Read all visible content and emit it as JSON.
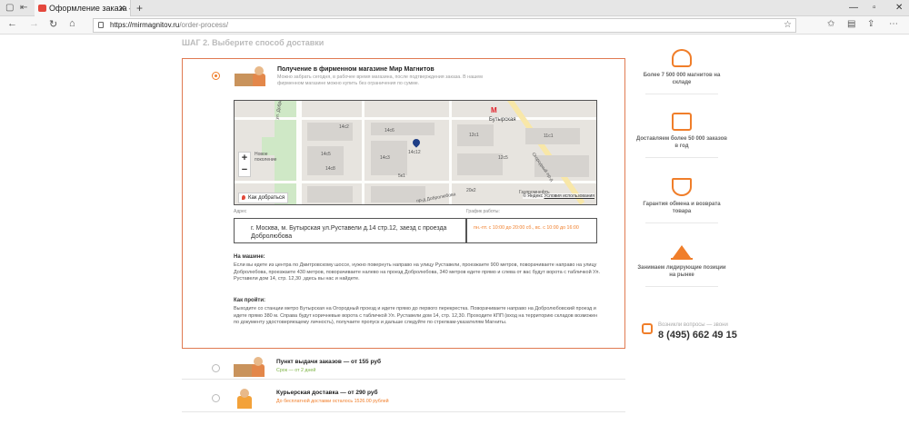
{
  "browser": {
    "tab_title": "Оформление заказа —",
    "url_host": "https://mirmagnitov.ru",
    "url_path": "/order-process/"
  },
  "step_heading": "ШАГ 2. Выберите способ доставки",
  "pickup_store": {
    "title": "Получение в фирменном магазине Мир Магнитов",
    "description": "Можно забрать сегодня, в рабочее время магазина, после подтверждения заказа. В нашем фирменном магазине можно купить без ограничения по сумме.",
    "map": {
      "labels": [
        "Бутырская",
        "14с12",
        "Новое поколение",
        "Огородный пр-д",
        "пр-д Добролюбова",
        "Газпромнефть",
        "ул. Добролюбова",
        "14с3",
        "12с1",
        "12с5",
        "14с2",
        "14с5",
        "14с6",
        "14с8",
        "11с1",
        "5к1",
        "20к2"
      ],
      "zoom_in": "+",
      "zoom_out": "−",
      "route_label": "Как добраться",
      "attribution_prefix": "© Яндекс",
      "attribution_link": "Условия использования"
    },
    "address_label": "Адрес",
    "hours_label": "График работы:",
    "address": "г. Москва, м. Бутырская ул.Руставели д.14 стр.12, заезд с проезда Добролюбова",
    "hours": "пн.-пт. с 10:00 до 20:00 сб., вс. с 10:00 до 16:00",
    "by_car_heading": "На машине:",
    "by_car_text": "Если вы едете из центра по Дмитровскому шоссе, нужно повернуть направо на улицу Руставели, проезжаете 900 метров, поворачиваете направо на улицу Добролюбова, проезжаете 430 метров, поворачиваете налево на проезд Добролюбова, 340 метров едете прямо и слева от вас будут ворота с табличкой Ул. Руставели дом 14, стр. 12,30 ,здесь вы нас и найдете.",
    "walk_heading": "Как пройти:",
    "walk_text": "Выходите со станции метро Бутырская на Огородный проезд и идете прямо до первого перекрестка. Поворачиваете направо на Добролюбовский проезд и идете прямо 380 м. Справа будут коричневые ворота с табличкой Ул. Руставели дом 14, стр. 12,30. Проходите КПП (вход на территорию складов возможен по документу удостоверяющему личность), получаете пропуск и дальше следуйте по стрелкам-указателям Магниты."
  },
  "pickup_point": {
    "title": "Пункт выдачи заказов — от 155 руб",
    "subtitle": "Срок — от 2 дней"
  },
  "courier": {
    "title": "Курьерская доставка — от 290 руб",
    "subtitle": "До бесплатной доставки осталось 1526.00 рублей"
  },
  "benefits": [
    {
      "icon": "magnet-icon",
      "text": "Более 7 500 000 магнитов на складе"
    },
    {
      "icon": "delivery-box-icon",
      "text": "Доставляем более 50 000 заказов в год"
    },
    {
      "icon": "shield-check-icon",
      "text": "Гарантия обмена и возврата товара"
    },
    {
      "icon": "mountain-flag-icon",
      "text": "Занимаем лидирующие позиции на рынке"
    }
  ],
  "contact": {
    "question": "Возникли вопросы — звони",
    "phone": "8 (495) 662 49 15"
  },
  "colors": {
    "accent": "#f07e2a",
    "border_active": "#e07a52"
  }
}
